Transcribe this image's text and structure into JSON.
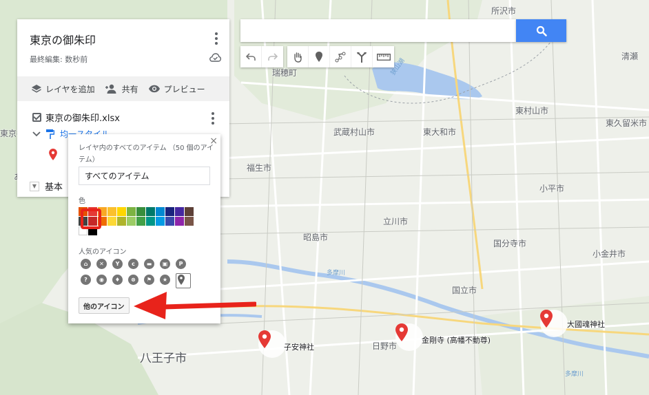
{
  "map": {
    "cities": [
      {
        "name": "所沢市"
      },
      {
        "name": "清瀬"
      },
      {
        "name": "瑞穂町"
      },
      {
        "name": "東村山市"
      },
      {
        "name": "武蔵村山市"
      },
      {
        "name": "東大和市"
      },
      {
        "name": "東久留米市"
      },
      {
        "name": "福生市"
      },
      {
        "name": "小平市"
      },
      {
        "name": "立川市"
      },
      {
        "name": "昭島市"
      },
      {
        "name": "国分寺市"
      },
      {
        "name": "小金井市"
      },
      {
        "name": "国立市"
      },
      {
        "name": "日野市"
      },
      {
        "name": "八王子市"
      }
    ],
    "water_labels": {
      "lake": "狭山湖",
      "river1": "多摩川",
      "river2": "多摩川"
    },
    "markers": [
      {
        "label": "子安神社"
      },
      {
        "label": "金剛寺 (高幡不動尊)"
      },
      {
        "label": "大國魂神社"
      }
    ],
    "partial_labels": {
      "left_edge": "東京都",
      "left_edge2": "あ"
    }
  },
  "search": {
    "placeholder": "",
    "value": ""
  },
  "toolbar": {
    "icons": [
      "undo-icon",
      "redo-icon",
      "hand-icon",
      "marker-icon",
      "draw-line-icon",
      "directions-icon",
      "ruler-icon"
    ]
  },
  "panel": {
    "title": "東京の御朱印",
    "last_edit": "最終編集: 数秒前",
    "actions": {
      "add_layer": "レイヤを追加",
      "share": "共有",
      "preview": "プレビュー"
    },
    "layer": {
      "name": "東京の御朱印.xlsx",
      "style_label": "均一スタイル"
    },
    "base_map": {
      "label": "基本"
    }
  },
  "popup": {
    "heading": "レイヤ内のすべてのアイテム （50 個のアイテム）",
    "input_value": "すべてのアイテム",
    "color_label": "色",
    "colors": [
      "#e65100",
      "#e53935",
      "#f9a825",
      "#fbc02d",
      "#ffd600",
      "#7cb342",
      "#388e3c",
      "#00796b",
      "#0288d1",
      "#1a237e",
      "#4527a0",
      "#5d4037",
      "#424242",
      "#c62828",
      "#ef6c00",
      "#fdd835",
      "#afb42b",
      "#9ccc65",
      "#43a047",
      "#009688",
      "#039be5",
      "#3949ab",
      "#8e24aa",
      "#795548",
      "#ffffff",
      "#000000"
    ],
    "selected_color": "#e53935",
    "icons_label": "人気のアイコン",
    "icons": [
      "home-icon",
      "restaurant-icon",
      "bar-icon",
      "cafe-icon",
      "lodging-icon",
      "shopping-icon",
      "parking-icon",
      "help-icon",
      "camera-icon",
      "walking-icon",
      "cycling-icon",
      "golf-icon",
      "star-icon",
      "pin-icon"
    ],
    "more_icons": "他のアイコン"
  }
}
